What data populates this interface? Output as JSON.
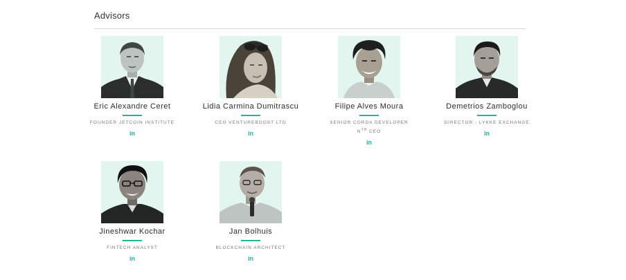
{
  "section": {
    "title": "Advisors"
  },
  "colors": {
    "accent": "#1bb99a",
    "photo_background": "#e3f5ef",
    "divider": "#d6d6d6"
  },
  "advisors": [
    {
      "name": "Eric Alexandre Ceret",
      "role": "FOUNDER JETCOIN INSTITUTE",
      "social_icon": "linkedin-icon",
      "social_label": "in"
    },
    {
      "name": "Lidia Carmina Dumitrascu",
      "role": "CEO VENTUREBOOST LTD",
      "social_icon": "linkedin-icon",
      "social_label": "in"
    },
    {
      "name": "Filipe Alves Moura",
      "role_line1": "SENIOR CORDA DEVELOPER",
      "role_line2_prefix": "N",
      "role_line2_sup": "TH",
      "role_line2_suffix": " CEO",
      "social_icon": "linkedin-icon",
      "social_label": "in"
    },
    {
      "name": "Demetrios Zamboglou",
      "role": "DIRECTOR - LYKKE EXCHANGE",
      "social_icon": "linkedin-icon",
      "social_label": "in"
    },
    {
      "name": "Jineshwar Kochar",
      "role": "FINTECH ANALYST",
      "social_icon": "linkedin-icon",
      "social_label": "in"
    },
    {
      "name": "Jan Bolhuis",
      "role": "BLOCKCHAIN ARCHITECT",
      "social_icon": "linkedin-icon",
      "social_label": "in"
    }
  ]
}
